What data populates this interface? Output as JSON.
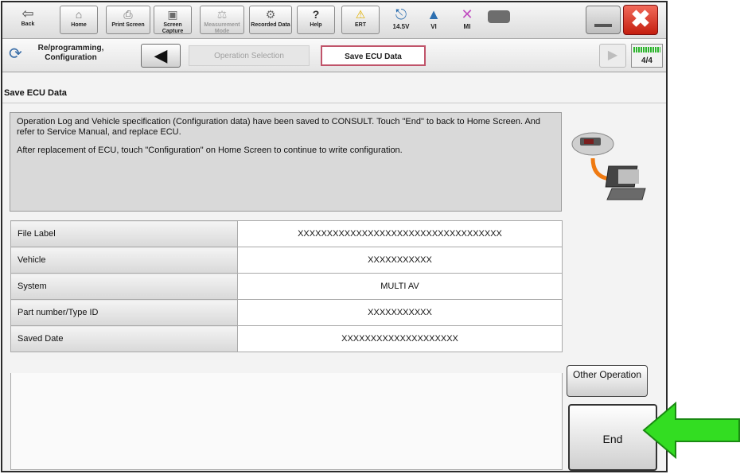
{
  "toolbar": {
    "back_label": "Back",
    "home_label": "Home",
    "print_label": "Print Screen",
    "capture_label": "Screen Capture",
    "measure_label": "Measurement Mode",
    "recorded_label": "Recorded Data",
    "help_label": "Help",
    "ert_label": "ERT",
    "voltage_label": "14.5V",
    "vi_label": "VI",
    "mi_label": "MI"
  },
  "nav": {
    "title": "Re/programming, Configuration",
    "crumb_inactive": "Operation Selection",
    "crumb_active": "Save ECU Data",
    "progress_text": "4/4",
    "progress_fraction": 1.0
  },
  "page": {
    "title": "Save ECU Data",
    "message_line1": "Operation Log and Vehicle specification (Configuration data) have been saved to CONSULT. Touch \"End\" to back to Home Screen. And refer to Service Manual, and replace ECU.",
    "message_line2": "After replacement of ECU, touch \"Configuration\" on Home Screen to continue to write configuration."
  },
  "table": {
    "rows": [
      {
        "key": "File Label",
        "value": "XXXXXXXXXXXXXXXXXXXXXXXXXXXXXXXXXXX"
      },
      {
        "key": "Vehicle",
        "value": "XXXXXXXXXXX"
      },
      {
        "key": "System",
        "value": "MULTI AV"
      },
      {
        "key": "Part number/Type ID",
        "value": "XXXXXXXXXXX"
      },
      {
        "key": "Saved Date",
        "value": "XXXXXXXXXXXXXXXXXXXX"
      }
    ]
  },
  "buttons": {
    "other_operation": "Other Operation",
    "end": "End"
  },
  "colors": {
    "arrow": "#33dd22",
    "close": "#d9301f",
    "active_crumb_border": "#c0546a"
  },
  "icons": {
    "back": "left-arrow-icon",
    "home": "home-icon",
    "print": "printer-icon",
    "capture": "camera-icon",
    "measure": "measurement-icon",
    "recorded": "recorded-data-icon",
    "help": "help-icon",
    "ert": "warning-icon",
    "vehicle": "car-icon",
    "signal": "signal-icon",
    "mi": "x-icon",
    "battery": "battery-icon"
  }
}
